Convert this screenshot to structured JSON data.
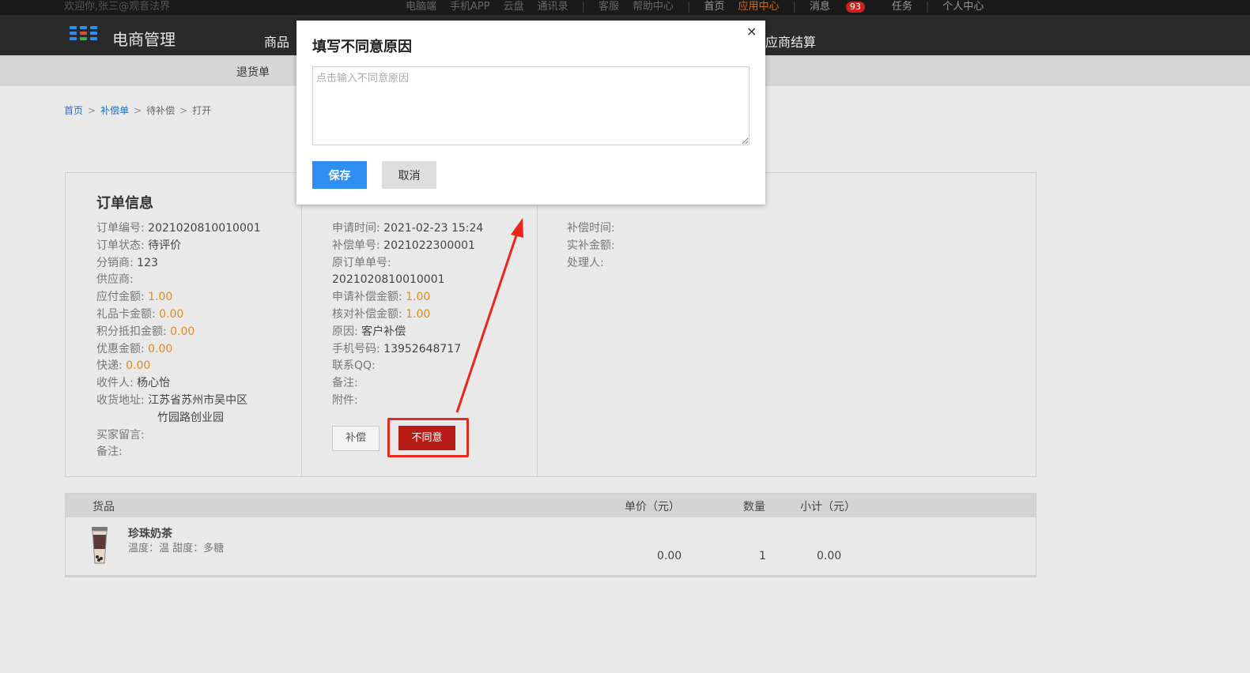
{
  "topbar": {
    "welcome": "欢迎你,张三@观音法界",
    "links": [
      "电脑端",
      "手机APP",
      "云盘",
      "通讯录",
      "客服",
      "帮助中心",
      "首页",
      "应用中心",
      "消息",
      "任务",
      "个人中心"
    ],
    "message_count": "93"
  },
  "header": {
    "logo_text": "电商管理",
    "nav": [
      "商品",
      "应商结算"
    ]
  },
  "subnav": {
    "item": "退货单"
  },
  "breadcrumb": [
    "首页",
    "补偿单",
    "待补偿",
    "打开"
  ],
  "order_info": {
    "title": "订单信息",
    "order_no_label": "订单编号:",
    "order_no": "2021020810010001",
    "status_label": "订单状态:",
    "status": "待评价",
    "distributor_label": "分销商:",
    "distributor": "123",
    "supplier_label": "供应商:",
    "payable_label": "应付金额:",
    "payable": "1.00",
    "giftcard_label": "礼品卡金额:",
    "giftcard": "0.00",
    "points_label": "积分抵扣金额:",
    "points": "0.00",
    "discount_label": "优惠金额:",
    "discount": "0.00",
    "shipping_label": "快递:",
    "shipping": "0.00",
    "receiver_label": "收件人:",
    "receiver": "杨心怡",
    "address_label": "收货地址:",
    "address_line1": "江苏省苏州市吴中区",
    "address_line2": "竹园路创业园",
    "buyer_msg_label": "买家留言:",
    "note_label": "备注:"
  },
  "comp_info": {
    "apply_time_label": "申请时间:",
    "apply_time": "2021-02-23 15:24",
    "comp_no_label": "补偿单号:",
    "comp_no": "2021022300001",
    "orig_order_label": "原订单单号:",
    "orig_order": "2021020810010001",
    "apply_amount_label": "申请补偿金额:",
    "apply_amount": "1.00",
    "verify_amount_label": "核对补偿金额:",
    "verify_amount": "1.00",
    "reason_label": "原因:",
    "reason": "客户补偿",
    "phone_label": "手机号码:",
    "phone": "13952648717",
    "qq_label": "联系QQ:",
    "remark_label": "备注:",
    "attach_label": "附件:",
    "btn_compensate": "补偿",
    "btn_reject": "不同意"
  },
  "process_info": {
    "comp_time_label": "补偿时间:",
    "actual_amount_label": "实补金额:",
    "handler_label": "处理人:"
  },
  "goods": {
    "headers": [
      "货品",
      "单价（元）",
      "数量",
      "小计（元）"
    ],
    "name": "珍珠奶茶",
    "attrs": "温度：温   甜度：多糖",
    "price": "0.00",
    "qty": "1",
    "subtotal": "0.00"
  },
  "modal": {
    "title": "填写不同意原因",
    "close": "×",
    "placeholder": "点击输入不同意原因",
    "value": "",
    "save": "保存",
    "cancel": "取消"
  },
  "colors": {
    "accent_orange": "#e08a1e",
    "reject_red": "#b81c16",
    "save_blue": "#2f8ff0",
    "highlight_red": "#e52a1e",
    "topbar_active": "#d46a1a"
  }
}
